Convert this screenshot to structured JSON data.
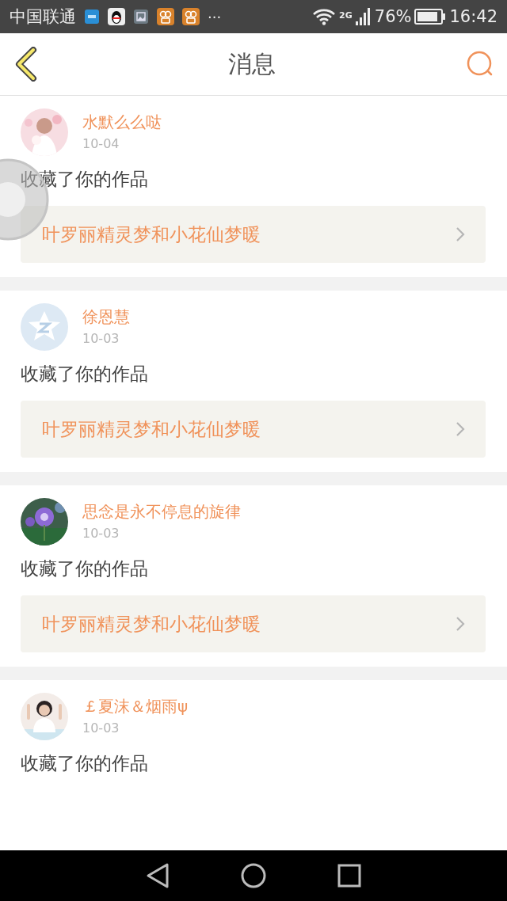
{
  "status_bar": {
    "carrier": "中国联通",
    "more": "···",
    "network": "2G",
    "battery": "76%",
    "time": "16:42"
  },
  "header": {
    "title": "消息"
  },
  "messages": [
    {
      "user": "水默么么哒",
      "date": "10-04",
      "action": "收藏了你的作品",
      "work": "叶罗丽精灵梦和小花仙梦暖"
    },
    {
      "user": "徐恩慧",
      "date": "10-03",
      "action": "收藏了你的作品",
      "work": "叶罗丽精灵梦和小花仙梦暖"
    },
    {
      "user": "思念是永不停息的旋律",
      "date": "10-03",
      "action": "收藏了你的作品",
      "work": "叶罗丽精灵梦和小花仙梦暖"
    },
    {
      "user": "￡夏沫＆烟雨ψ",
      "date": "10-03",
      "action": "收藏了你的作品"
    }
  ]
}
